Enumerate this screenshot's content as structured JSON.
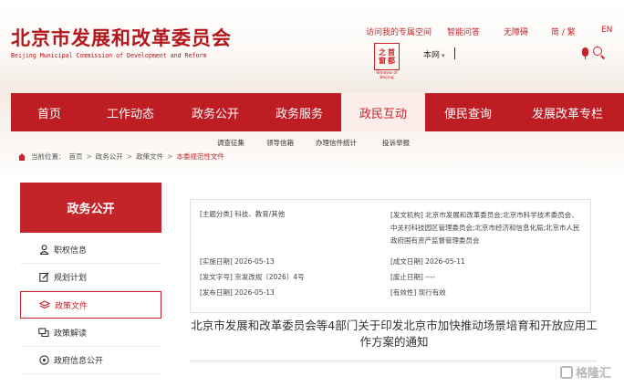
{
  "header": {
    "site_title": "北京市发展和改革委员会",
    "site_subtitle": "Beijing Municipal Commission of Development and Reform",
    "top_links": [
      "访问我的专属空间",
      "智能问答",
      "无障碍",
      "简 / 繁",
      "EN"
    ],
    "seal_glyphs": [
      "之",
      "首",
      "窗",
      "都"
    ],
    "seal_caption": "Window of Beijing",
    "search_scope": "本网",
    "search_value": ""
  },
  "nav": {
    "items": [
      "首页",
      "工作动态",
      "政务公开",
      "政务服务",
      "政民互动",
      "便民查询",
      "发展改革专栏"
    ],
    "active_index": 4
  },
  "subnav": {
    "items": [
      "调查征集",
      "领导信箱",
      "办理信件统计",
      "投诉举报"
    ]
  },
  "breadcrumb": {
    "prefix": "当前位置：",
    "items": [
      "首页",
      "政务公开",
      "政策文件",
      "本委规范性文件"
    ],
    "separator": ">"
  },
  "sidebar": {
    "title": "政务公开",
    "items": [
      {
        "label": "职权信息",
        "icon": "person-icon"
      },
      {
        "label": "规划计划",
        "icon": "edit-icon"
      },
      {
        "label": "政策文件",
        "icon": "layers-icon"
      },
      {
        "label": "政策解读",
        "icon": "chat-icon"
      },
      {
        "label": "政府信息公开",
        "icon": "info-circle-icon"
      }
    ],
    "active_index": 2
  },
  "doc": {
    "subject": "[主题分类] 科技、教育/其他",
    "issuer": "[发文机构] 北京市发展和改革委员会;北京市科学技术委员会、中关村科技园区管理委员会;北京市经济和信息化局;北京市人民政府国有资产监督管理委员会",
    "effective_date": "[实施日期] 2026-05-13",
    "doc_number": "[发文字号] 京发改规〔2026〕4号",
    "publish_date": "[发布日期] 2026-05-13",
    "issue_date": "[成文日期] 2026-05-11",
    "repeal_date": "[废止日期] ----",
    "validity": "[有效性] 现行有效",
    "title": "北京市发展和改革委员会等4部门关于印发北京市加快推动场景培育和开放应用工作方案的通知"
  },
  "watermark": "格隆汇",
  "colors": {
    "brand_red": "#bd1d23",
    "accent_red": "#c7222a"
  }
}
